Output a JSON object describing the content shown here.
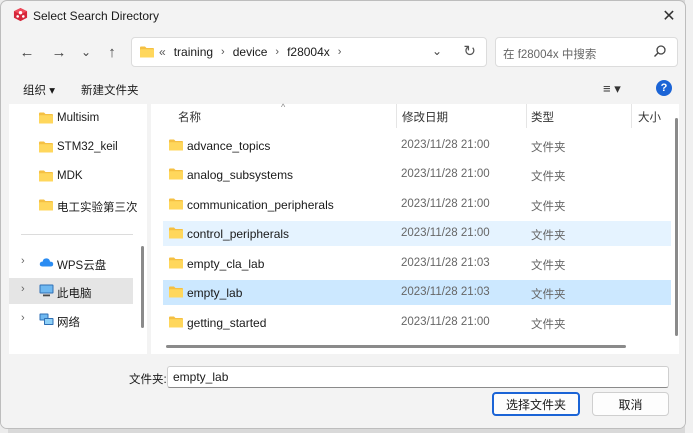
{
  "window": {
    "title": "Select Search Directory",
    "close_glyph": "✕"
  },
  "nav": {
    "back_glyph": "←",
    "forward_glyph": "→",
    "history_glyph": "⌄",
    "up_glyph": "↑",
    "overflow_glyph": "«",
    "breadcrumbs": [
      "training",
      "device",
      "f28004x"
    ],
    "crumb_sep_glyph": "›",
    "dropdown_glyph": "⌄",
    "refresh_glyph": "↻",
    "search_placeholder": "在 f28004x 中搜索"
  },
  "toolbar": {
    "organize": "组织 ▾",
    "new_folder": "新建文件夹",
    "view_glyph": "≡ ▾",
    "help": "?"
  },
  "sidebar": {
    "folders": [
      "Multisim",
      "STM32_keil",
      "MDK",
      "电工实验第三次"
    ],
    "locations": [
      {
        "label": "WPS云盘",
        "icon": "cloud-icon"
      },
      {
        "label": "此电脑",
        "icon": "computer-icon",
        "selected": true
      },
      {
        "label": "网络",
        "icon": "network-icon"
      }
    ],
    "chevron_glyph": "›"
  },
  "columns": {
    "name": "名称",
    "modified": "修改日期",
    "type": "类型",
    "size": "大小"
  },
  "files": [
    {
      "name": "advance_topics",
      "modified": "2023/11/28 21:00",
      "type": "文件夹"
    },
    {
      "name": "analog_subsystems",
      "modified": "2023/11/28 21:00",
      "type": "文件夹"
    },
    {
      "name": "communication_peripherals",
      "modified": "2023/11/28 21:00",
      "type": "文件夹"
    },
    {
      "name": "control_peripherals",
      "modified": "2023/11/28 21:00",
      "type": "文件夹",
      "state": "hover"
    },
    {
      "name": "empty_cla_lab",
      "modified": "2023/11/28 21:03",
      "type": "文件夹"
    },
    {
      "name": "empty_lab",
      "modified": "2023/11/28 21:03",
      "type": "文件夹",
      "state": "selected"
    },
    {
      "name": "getting_started",
      "modified": "2023/11/28 21:00",
      "type": "文件夹"
    }
  ],
  "footer": {
    "folder_label": "文件夹:",
    "folder_value": "empty_lab",
    "select_button": "选择文件夹",
    "cancel_button": "取消"
  },
  "colors": {
    "folder_yellow": "#f5c043",
    "selection": "#cce8ff",
    "hover": "#e5f3ff",
    "accent": "#1b64d6"
  }
}
